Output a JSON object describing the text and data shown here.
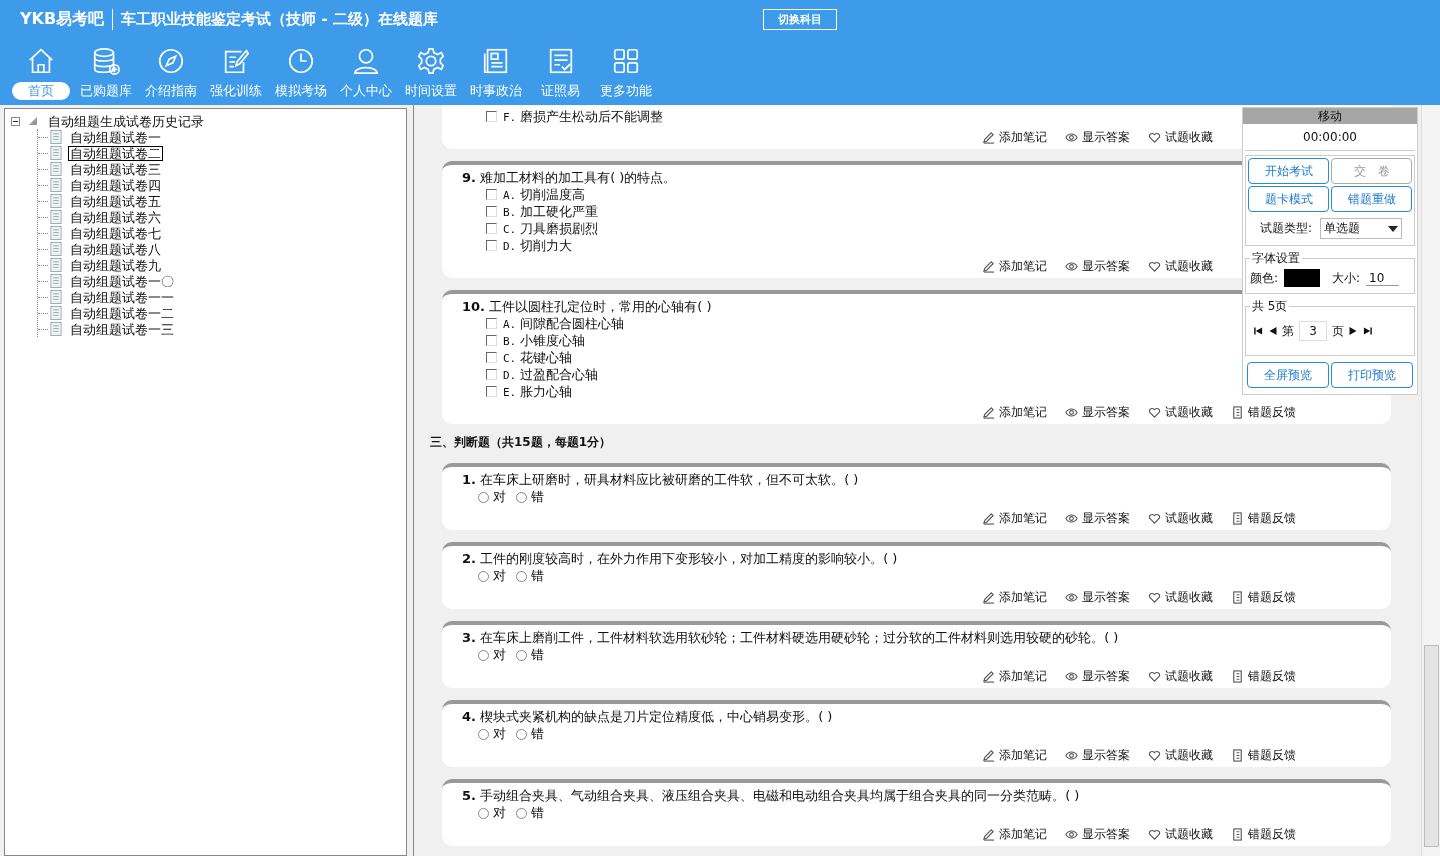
{
  "header": {
    "logo": "YKB易考吧",
    "title": "车工职业技能鉴定考试（技师 - 二级）在线题库",
    "switch_button": "切换科目"
  },
  "nav": [
    {
      "kind": "home",
      "label": "首页",
      "selected": true
    },
    {
      "kind": "database",
      "label": "已购题库",
      "selected": false
    },
    {
      "kind": "compass",
      "label": "介绍指南",
      "selected": false
    },
    {
      "kind": "edit",
      "label": "强化训练",
      "selected": false
    },
    {
      "kind": "clock",
      "label": "模拟考场",
      "selected": false
    },
    {
      "kind": "user",
      "label": "个人中心",
      "selected": false
    },
    {
      "kind": "gear",
      "label": "时间设置",
      "selected": false
    },
    {
      "kind": "news",
      "label": "时事政治",
      "selected": false
    },
    {
      "kind": "list",
      "label": "证照易",
      "selected": false
    },
    {
      "kind": "grid",
      "label": "更多功能",
      "selected": false
    }
  ],
  "tree": {
    "label": "自动组题生成试卷历史记录",
    "expanded": true,
    "children": [
      {
        "label": "自动组题试卷一",
        "selected": false
      },
      {
        "label": "自动组题试卷二",
        "selected": true
      },
      {
        "label": "自动组题试卷三",
        "selected": false
      },
      {
        "label": "自动组题试卷四",
        "selected": false
      },
      {
        "label": "自动组题试卷五",
        "selected": false
      },
      {
        "label": "自动组题试卷六",
        "selected": false
      },
      {
        "label": "自动组题试卷七",
        "selected": false
      },
      {
        "label": "自动组题试卷八",
        "selected": false
      },
      {
        "label": "自动组题试卷九",
        "selected": false
      },
      {
        "label": "自动组题试卷一〇",
        "selected": false
      },
      {
        "label": "自动组题试卷一一",
        "selected": false
      },
      {
        "label": "自动组题试卷一二",
        "selected": false
      },
      {
        "label": "自动组题试卷一三",
        "selected": false
      }
    ]
  },
  "content": [
    {
      "kind": "multiple",
      "options": [
        {
          "label": "F.",
          "text": "磨损产生松动后不能调整",
          "checked": false
        }
      ],
      "actions": [
        {
          "kind": "note",
          "label": "添加笔记"
        },
        {
          "kind": "answer",
          "label": "显示答案"
        },
        {
          "kind": "favorite",
          "label": "试题收藏"
        }
      ]
    },
    {
      "kind": "multiple",
      "number": "9.",
      "text": "难加工材料的加工具有( )的特点。",
      "options": [
        {
          "label": "A.",
          "text": "切削温度高",
          "checked": false
        },
        {
          "label": "B.",
          "text": "加工硬化严重",
          "checked": false
        },
        {
          "label": "C.",
          "text": "刀具磨损剧烈",
          "checked": false
        },
        {
          "label": "D.",
          "text": "切削力大",
          "checked": false
        }
      ],
      "actions": [
        {
          "kind": "note",
          "label": "添加笔记"
        },
        {
          "kind": "answer",
          "label": "显示答案"
        },
        {
          "kind": "favorite",
          "label": "试题收藏"
        }
      ]
    },
    {
      "kind": "multiple",
      "number": "10.",
      "text": "工件以圆柱孔定位时，常用的心轴有( )",
      "options": [
        {
          "label": "A.",
          "text": "间隙配合圆柱心轴",
          "checked": false
        },
        {
          "label": "B.",
          "text": "小锥度心轴",
          "checked": false
        },
        {
          "label": "C.",
          "text": "花键心轴",
          "checked": false
        },
        {
          "label": "D.",
          "text": "过盈配合心轴",
          "checked": false
        },
        {
          "label": "E.",
          "text": "胀力心轴",
          "checked": false
        }
      ],
      "actions": [
        {
          "kind": "note",
          "label": "添加笔记"
        },
        {
          "kind": "answer",
          "label": "显示答案"
        },
        {
          "kind": "favorite",
          "label": "试题收藏"
        },
        {
          "kind": "feedback",
          "label": "错题反馈"
        }
      ]
    },
    {
      "kind": "heading",
      "text": "三、判断题（共15题，每题1分）"
    },
    {
      "kind": "judge",
      "number": "1.",
      "text": "在车床上研磨时，研具材料应比被研磨的工件软，但不可太软。( )",
      "options": [
        {
          "text": "对",
          "selected": false
        },
        {
          "text": "错",
          "selected": false
        }
      ],
      "actions": [
        {
          "kind": "note",
          "label": "添加笔记"
        },
        {
          "kind": "answer",
          "label": "显示答案"
        },
        {
          "kind": "favorite",
          "label": "试题收藏"
        },
        {
          "kind": "feedback",
          "label": "错题反馈"
        }
      ]
    },
    {
      "kind": "judge",
      "number": "2.",
      "text": "工件的刚度较高时，在外力作用下变形较小，对加工精度的影响较小。( )",
      "options": [
        {
          "text": "对",
          "selected": false
        },
        {
          "text": "错",
          "selected": false
        }
      ],
      "actions": [
        {
          "kind": "note",
          "label": "添加笔记"
        },
        {
          "kind": "answer",
          "label": "显示答案"
        },
        {
          "kind": "favorite",
          "label": "试题收藏"
        },
        {
          "kind": "feedback",
          "label": "错题反馈"
        }
      ]
    },
    {
      "kind": "judge",
      "number": "3.",
      "text": "在车床上磨削工件，工件材料软选用软砂轮；工件材料硬选用硬砂轮；过分软的工件材料则选用较硬的砂轮。( )",
      "options": [
        {
          "text": "对",
          "selected": false
        },
        {
          "text": "错",
          "selected": false
        }
      ],
      "actions": [
        {
          "kind": "note",
          "label": "添加笔记"
        },
        {
          "kind": "answer",
          "label": "显示答案"
        },
        {
          "kind": "favorite",
          "label": "试题收藏"
        },
        {
          "kind": "feedback",
          "label": "错题反馈"
        }
      ]
    },
    {
      "kind": "judge",
      "number": "4.",
      "text": "楔块式夹紧机构的缺点是刀片定位精度低，中心销易变形。( )",
      "options": [
        {
          "text": "对",
          "selected": false
        },
        {
          "text": "错",
          "selected": false
        }
      ],
      "actions": [
        {
          "kind": "note",
          "label": "添加笔记"
        },
        {
          "kind": "answer",
          "label": "显示答案"
        },
        {
          "kind": "favorite",
          "label": "试题收藏"
        },
        {
          "kind": "feedback",
          "label": "错题反馈"
        }
      ]
    },
    {
      "kind": "judge",
      "number": "5.",
      "text": "手动组合夹具、气动组合夹具、液压组合夹具、电磁和电动组合夹具均属于组合夹具的同一分类范畴。( )",
      "options": [
        {
          "text": "对",
          "selected": false
        },
        {
          "text": "错",
          "selected": false
        }
      ],
      "actions": [
        {
          "kind": "note",
          "label": "添加笔记"
        },
        {
          "kind": "answer",
          "label": "显示答案"
        },
        {
          "kind": "favorite",
          "label": "试题收藏"
        },
        {
          "kind": "feedback",
          "label": "错题反馈"
        }
      ]
    }
  ],
  "panel": {
    "title": "移动",
    "timer": "00:00:00",
    "buttons": [
      {
        "label": "开始考试",
        "disabled": false
      },
      {
        "label": "交　卷",
        "disabled": true
      },
      {
        "label": "题卡模式",
        "disabled": false
      },
      {
        "label": "错题重做",
        "disabled": false
      }
    ],
    "type_label": "试题类型:",
    "type_value": "单选题",
    "font_group": "字体设置",
    "color_label": "颜色:",
    "color": "#000000",
    "size_label": "大小:",
    "size_value": "10",
    "page_group": "共 5页",
    "page_prefix": "第",
    "page_value": "3",
    "page_suffix": "页",
    "bottom_buttons": [
      "全屏预览",
      "打印预览"
    ]
  }
}
